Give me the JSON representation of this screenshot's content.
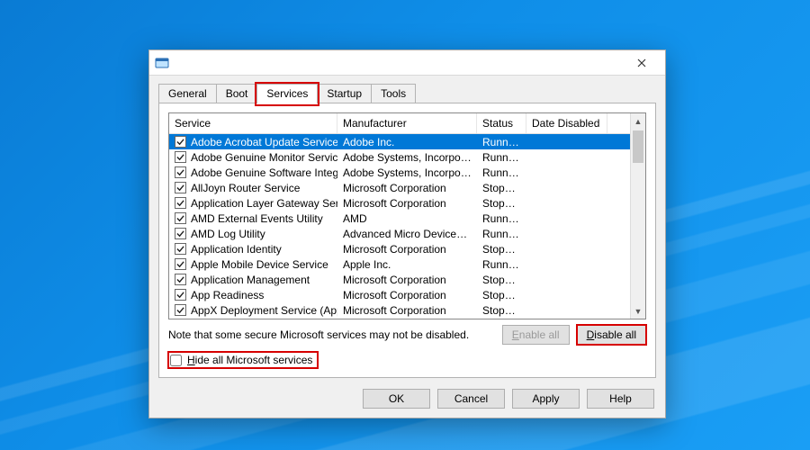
{
  "tabs": [
    "General",
    "Boot",
    "Services",
    "Startup",
    "Tools"
  ],
  "activeTab": 2,
  "columns": {
    "service": "Service",
    "manufacturer": "Manufacturer",
    "status": "Status",
    "dateDisabled": "Date Disabled"
  },
  "rows": [
    {
      "service": "Adobe Acrobat Update Service",
      "manufacturer": "Adobe Inc.",
      "status": "Running",
      "selected": true
    },
    {
      "service": "Adobe Genuine Monitor Service",
      "manufacturer": "Adobe Systems, Incorpora...",
      "status": "Running"
    },
    {
      "service": "Adobe Genuine Software Integri...",
      "manufacturer": "Adobe Systems, Incorpora...",
      "status": "Running"
    },
    {
      "service": "AllJoyn Router Service",
      "manufacturer": "Microsoft Corporation",
      "status": "Stopped"
    },
    {
      "service": "Application Layer Gateway Service",
      "manufacturer": "Microsoft Corporation",
      "status": "Stopped"
    },
    {
      "service": "AMD External Events Utility",
      "manufacturer": "AMD",
      "status": "Running"
    },
    {
      "service": "AMD Log Utility",
      "manufacturer": "Advanced Micro Devices, I...",
      "status": "Running"
    },
    {
      "service": "Application Identity",
      "manufacturer": "Microsoft Corporation",
      "status": "Stopped"
    },
    {
      "service": "Apple Mobile Device Service",
      "manufacturer": "Apple Inc.",
      "status": "Running"
    },
    {
      "service": "Application Management",
      "manufacturer": "Microsoft Corporation",
      "status": "Stopped"
    },
    {
      "service": "App Readiness",
      "manufacturer": "Microsoft Corporation",
      "status": "Stopped"
    },
    {
      "service": "AppX Deployment Service (AppX...",
      "manufacturer": "Microsoft Corporation",
      "status": "Stopped"
    }
  ],
  "note": "Note that some secure Microsoft services may not be disabled.",
  "enableAll": "Enable all",
  "disableAll": "Disable all",
  "hideLabelPre": "H",
  "hideLabelPost": "ide all Microsoft services",
  "buttons": {
    "ok": "OK",
    "cancel": "Cancel",
    "apply": "Apply",
    "help": "Help"
  }
}
